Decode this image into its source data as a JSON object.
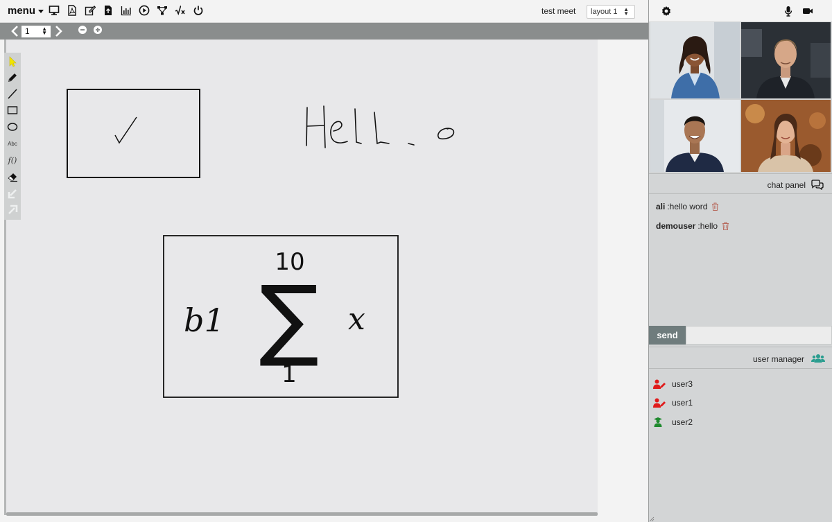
{
  "topbar": {
    "menu_label": "menu",
    "icons": [
      "monitor-icon",
      "pdf-icon",
      "edit-icon",
      "file-upload-icon",
      "chart-icon",
      "play-icon",
      "diagram-icon",
      "sqrt-x-icon",
      "power-icon"
    ],
    "meeting_name": "test meet",
    "layout_select": "layout 1"
  },
  "pagebar": {
    "page_value": "1"
  },
  "board": {
    "tools": [
      "pointer-icon",
      "pencil-icon",
      "line-icon",
      "rectangle-icon",
      "ellipse-icon",
      "text-tool",
      "formula-tool",
      "eraser-icon",
      "undo-arrow-icon",
      "redo-arrow-icon"
    ],
    "text_tool_label": "Abc",
    "formula_tool_label": "f()",
    "handwriting": "Hello",
    "formula": {
      "coefficient": "b1",
      "symbol": "∑",
      "upper": "10",
      "lower": "1",
      "variable": "x"
    }
  },
  "right": {
    "participants": [
      "participant-1",
      "participant-2",
      "participant-3",
      "participant-4"
    ],
    "chat": {
      "title": "chat panel",
      "messages": [
        {
          "sender": "ali",
          "text": ":hello word"
        },
        {
          "sender": "demouser",
          "text": ":hello"
        }
      ],
      "send_label": "send",
      "input_value": ""
    },
    "user_manager": {
      "title": "user manager",
      "users": [
        {
          "name": "user3",
          "role": "presenter",
          "color": "#e01b1b"
        },
        {
          "name": "user1",
          "role": "presenter",
          "color": "#e01b1b"
        },
        {
          "name": "user2",
          "role": "student",
          "color": "#1f8a2e"
        }
      ]
    }
  },
  "colors": {
    "accent_yellow": "#f2e600",
    "presenter_red": "#e01b1b",
    "student_green": "#1f8a2e",
    "send_button": "#6f7c7d",
    "team_icon": "#2a9d8f"
  }
}
